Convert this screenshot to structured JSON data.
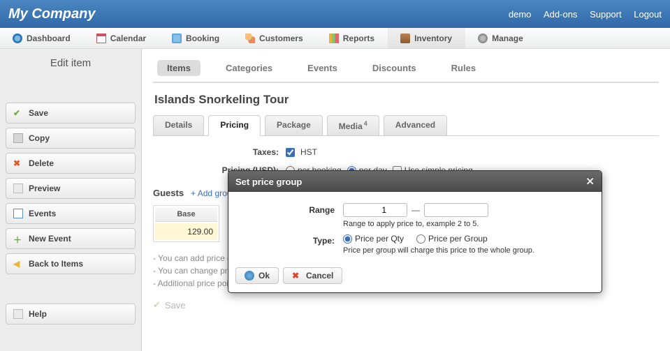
{
  "header": {
    "brand": "My Company",
    "links": [
      "demo",
      "Add-ons",
      "Support",
      "Logout"
    ]
  },
  "nav": {
    "items": [
      "Dashboard",
      "Calendar",
      "Booking",
      "Customers",
      "Reports",
      "Inventory",
      "Manage"
    ],
    "active": "Inventory"
  },
  "sidebar": {
    "title": "Edit item",
    "save": "Save",
    "copy": "Copy",
    "delete": "Delete",
    "preview": "Preview",
    "events": "Events",
    "new_event": "New Event",
    "back": "Back to Items",
    "help": "Help"
  },
  "subtabs": [
    "Items",
    "Categories",
    "Events",
    "Discounts",
    "Rules"
  ],
  "subtabs_active": "Items",
  "page_title": "Islands Snorkeling Tour",
  "detail_tabs": {
    "items": [
      "Details",
      "Pricing",
      "Package",
      "Media",
      "Advanced"
    ],
    "media_badge": "4",
    "active": "Pricing"
  },
  "form": {
    "taxes_label": "Taxes:",
    "tax_name": "HST",
    "pricing_label": "Pricing (USD):",
    "pricing_options": [
      "per booking",
      "per day",
      "Use simple pricing"
    ],
    "pricing_selected": "per day",
    "guests_label": "Guests",
    "add_group": "+ Add group",
    "table_header": "Base",
    "table_value": "129.00",
    "notes": [
      "- You can add price groups",
      "- You can change pricing",
      "- Additional price point"
    ],
    "save_disabled": "Save"
  },
  "modal": {
    "title": "Set price group",
    "range_label": "Range",
    "range_from": "1",
    "range_to": "",
    "range_hint": "Range to apply price to, example 2 to 5.",
    "type_label": "Type:",
    "type_options": [
      "Price per Qty",
      "Price per Group"
    ],
    "type_selected": "Price per Qty",
    "type_hint": "Price per group will charge this price to the whole group.",
    "ok": "Ok",
    "cancel": "Cancel"
  }
}
